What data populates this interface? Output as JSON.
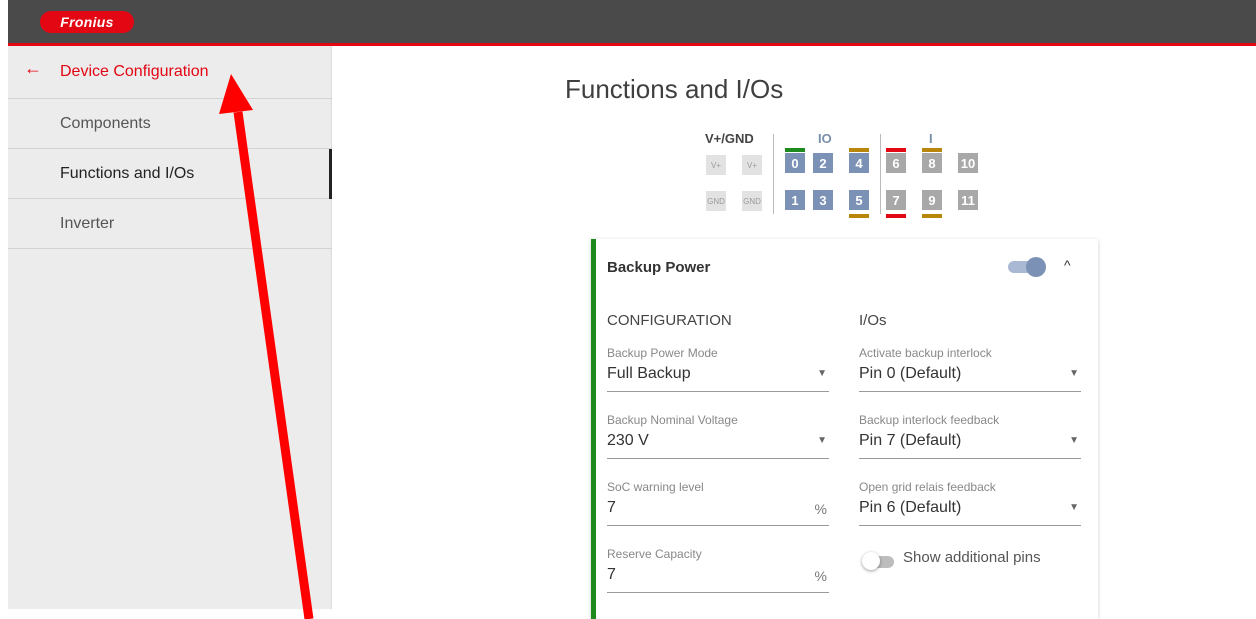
{
  "header": {
    "logo_text": "Fronius",
    "brand_color": "#e30613"
  },
  "sidebar": {
    "back_icon": "arrow-left-icon",
    "back_label": "Device Configuration",
    "items": [
      {
        "label": "Components",
        "active": false
      },
      {
        "label": "Functions and I/Os",
        "active": true
      },
      {
        "label": "Inverter",
        "active": false
      }
    ]
  },
  "main": {
    "title": "Functions and I/Os"
  },
  "pins": {
    "groups": [
      {
        "label": "V+/GND"
      },
      {
        "label": "IO"
      },
      {
        "label": "I"
      }
    ],
    "vplus": "V+",
    "gnd": "GND",
    "top_row": [
      "0",
      "2",
      "4",
      "6",
      "8",
      "10"
    ],
    "bottom_row": [
      "1",
      "3",
      "5",
      "7",
      "9",
      "11"
    ]
  },
  "card": {
    "title": "Backup Power",
    "enabled": true,
    "accent_color": "#1e8a1e",
    "expand_icon": "chevron-up-icon",
    "configuration_title": "CONFIGURATION",
    "ios_title": "I/Os",
    "configuration": [
      {
        "label": "Backup Power Mode",
        "value": "Full Backup",
        "control": "dropdown"
      },
      {
        "label": "Backup Nominal Voltage",
        "value": "230 V",
        "control": "dropdown"
      },
      {
        "label": "SoC warning level",
        "value": "7",
        "unit": "%"
      },
      {
        "label": "Reserve Capacity",
        "value": "7",
        "unit": "%"
      }
    ],
    "ios": [
      {
        "label": "Activate backup interlock",
        "value": "Pin 0 (Default)",
        "control": "dropdown"
      },
      {
        "label": "Backup interlock feedback",
        "value": "Pin 7 (Default)",
        "control": "dropdown"
      },
      {
        "label": "Open grid relais feedback",
        "value": "Pin 6 (Default)",
        "control": "dropdown"
      }
    ],
    "show_additional_pins_label": "Show additional pins",
    "show_additional_pins": false
  }
}
